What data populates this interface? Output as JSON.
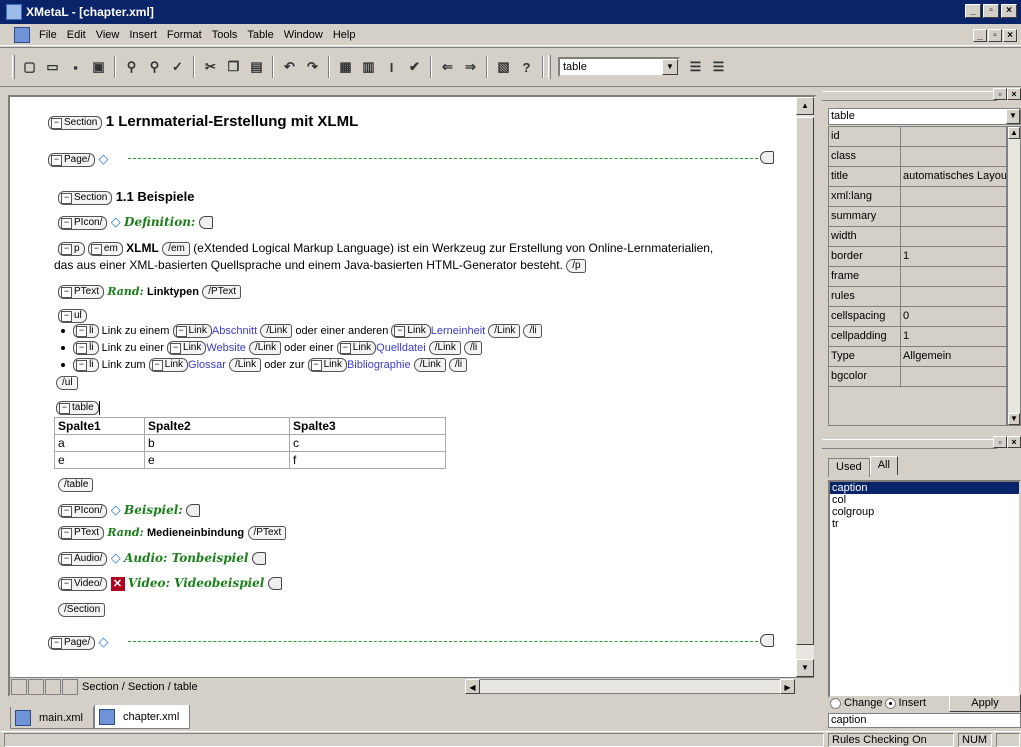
{
  "window": {
    "title": "XMetaL - [chapter.xml]"
  },
  "menu": [
    "File",
    "Edit",
    "View",
    "Insert",
    "Format",
    "Tools",
    "Table",
    "Window",
    "Help"
  ],
  "toolbar": {
    "element_select": "table"
  },
  "doc": {
    "section_tag": "Section",
    "page_tag": "Page/",
    "h1": "1 Lernmaterial-Erstellung mit XLML",
    "h2": "1.1 Beispiele",
    "picon_tag": "PIcon/",
    "definition": "Definition:",
    "p_tag": "p",
    "em_tag": "em",
    "em_end": "/em",
    "xlml": "XLML",
    "para1": "(eXtended Logical Markup Language) ist ein Werkzeug zur Erstellung von Online-Lernmaterialien,",
    "para2": "das aus einer XML-basierten Quellsprache und einem Java-basierten HTML-Generator besteht.",
    "p_end": "/p",
    "ptext_tag": "PText",
    "ptext_end": "/PText",
    "rand": "Rand:",
    "linktypen": "Linktypen",
    "ul_tag": "ul",
    "ul_end": "/ul",
    "li_tag": "li",
    "li_end": "/li",
    "link_tag": "Link",
    "link_end": "/Link",
    "li1_a": "Link zu einem",
    "li1_link1": "Abschnitt",
    "li1_b": "oder einer anderen",
    "li1_link2": "Lerneinheit",
    "li2_a": "Link zu einer",
    "li2_link1": "Website",
    "li2_b": "oder einer",
    "li2_link2": "Quelldatei",
    "li3_a": "Link zum",
    "li3_link1": "Glossar",
    "li3_b": "oder zur",
    "li3_link2": "Bibliographie",
    "table_tag": "table",
    "table_end": "/table",
    "table": {
      "headers": [
        "Spalte1",
        "Spalte2",
        "Spalte3"
      ],
      "rows": [
        [
          "a",
          "b",
          "c"
        ],
        [
          "e",
          "e",
          "f"
        ]
      ]
    },
    "beispiel": "Beispiel:",
    "medien": "Medieneinbindung",
    "audio_tag": "Audio/",
    "audio": "Audio: Tonbeispiel",
    "video_tag": "Video/",
    "video": "Video: Videobeispiel",
    "section_end": "/Section"
  },
  "editor_path": "Section / Section / table",
  "attributes": {
    "element": "table",
    "rows": [
      {
        "name": "id",
        "value": ""
      },
      {
        "name": "class",
        "value": ""
      },
      {
        "name": "title",
        "value": "automatisches Layout"
      },
      {
        "name": "xml:lang",
        "value": ""
      },
      {
        "name": "summary",
        "value": ""
      },
      {
        "name": "width",
        "value": ""
      },
      {
        "name": "border",
        "value": "1"
      },
      {
        "name": "frame",
        "value": ""
      },
      {
        "name": "rules",
        "value": ""
      },
      {
        "name": "cellspacing",
        "value": "0"
      },
      {
        "name": "cellpadding",
        "value": "1"
      },
      {
        "name": "Type",
        "value": "Allgemein"
      },
      {
        "name": "bgcolor",
        "value": ""
      }
    ]
  },
  "elements": {
    "tabs": [
      "Used",
      "All"
    ],
    "items": [
      "caption",
      "col",
      "colgroup",
      "tr"
    ],
    "selected": "caption",
    "change": "Change",
    "insert": "Insert",
    "apply": "Apply",
    "current": "caption"
  },
  "doctabs": [
    "main.xml",
    "chapter.xml"
  ],
  "status": {
    "rules": "Rules Checking On",
    "num": "NUM"
  }
}
